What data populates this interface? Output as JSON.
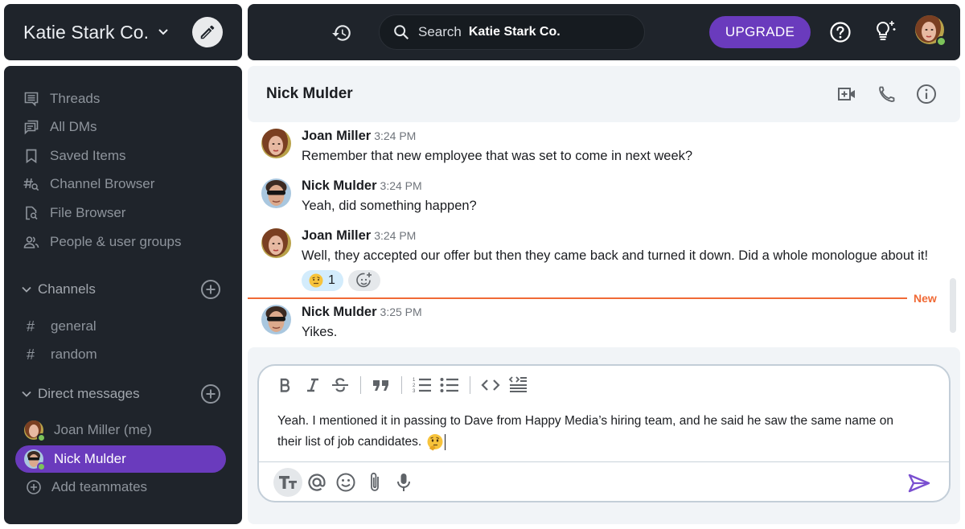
{
  "workspace": {
    "name": "Katie Stark Co.",
    "compose_icon": "pencil-icon",
    "chevron_icon": "chevron-down-icon"
  },
  "topbar": {
    "history_icon": "history-icon",
    "search": {
      "label": "Search",
      "scope": "Katie Stark Co."
    },
    "upgrade_label": "UPGRADE",
    "help_icon": "help-circle-icon",
    "tips_icon": "lightbulb-sparkle-icon",
    "profile": {
      "name": "Joan Miller",
      "status": "online"
    }
  },
  "colors": {
    "dark_panel": "#1f242b",
    "accent": "#6a3bbd",
    "presence_online": "#7cc35a",
    "new_divider": "#f06a36",
    "reaction_bg": "#d3ecfc",
    "light_panel": "#f1f4f7"
  },
  "sidebar": {
    "nav_items": [
      {
        "label": "Threads",
        "icon": "threads-icon"
      },
      {
        "label": "All DMs",
        "icon": "all-dms-icon"
      },
      {
        "label": "Saved Items",
        "icon": "bookmark-icon"
      },
      {
        "label": "Channel Browser",
        "icon": "channel-browser-icon"
      },
      {
        "label": "File Browser",
        "icon": "file-search-icon"
      },
      {
        "label": "People & user groups",
        "icon": "people-icon"
      }
    ],
    "channels": {
      "label": "Channels",
      "items": [
        {
          "label": "general"
        },
        {
          "label": "random"
        }
      ]
    },
    "direct_messages": {
      "label": "Direct messages",
      "items": [
        {
          "label": "Joan Miller (me)",
          "status": "online",
          "active": false
        },
        {
          "label": "Nick Mulder",
          "status": "online",
          "active": true
        }
      ],
      "add_label": "Add teammates"
    }
  },
  "conversation": {
    "title": "Nick Mulder",
    "actions": [
      {
        "name": "video-call",
        "icon": "video-plus-icon"
      },
      {
        "name": "phone-call",
        "icon": "phone-icon"
      },
      {
        "name": "info",
        "icon": "info-icon"
      }
    ],
    "messages": [
      {
        "author": "Joan Miller",
        "time": "3:24 PM",
        "text": "Remember that new employee that was set to come in next week?"
      },
      {
        "author": "Nick Mulder",
        "time": "3:24 PM",
        "text": "Yeah, did something happen?"
      },
      {
        "author": "Joan Miller",
        "time": "3:24 PM",
        "text": "Well, they accepted our offer but then they came back and turned it down. Did a whole monologue about it!",
        "reactions": [
          {
            "emoji": "🤨",
            "count": "1"
          }
        ]
      },
      {
        "author": "Nick Mulder",
        "time": "3:25 PM",
        "text": "Yikes."
      }
    ],
    "new_marker": "New"
  },
  "composer": {
    "format_tools": [
      "bold",
      "italic",
      "strikethrough",
      "quote",
      "ordered-list",
      "bulleted-list",
      "code",
      "code-block"
    ],
    "draft": "Yeah. I mentioned it in passing to Dave from Happy Media’s hiring team, and he said he saw the same name on their list of job candidates.",
    "draft_emoji": "🤔",
    "bottom_tools": [
      "text-format",
      "mention",
      "emoji",
      "attach",
      "microphone"
    ],
    "send_icon": "send-icon"
  }
}
